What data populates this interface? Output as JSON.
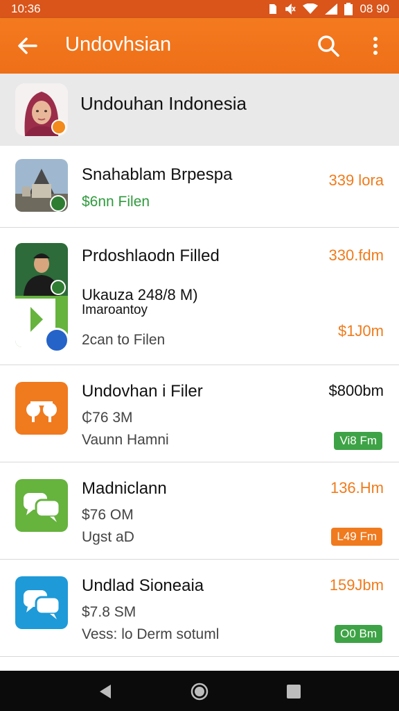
{
  "status_bar": {
    "time": "10:36",
    "clock_right": "08 90"
  },
  "app_bar": {
    "title": "Undovhsian"
  },
  "header": {
    "title": "Undouhan Indonesia"
  },
  "items": [
    {
      "title": "Snahablam Brpespa",
      "sub1": "$6nn Filen",
      "sub2": "",
      "price": "339 lora",
      "price2": "",
      "pill": ""
    },
    {
      "title": "Prdoshlaodn Filled",
      "sub1": "Ukauza 248/8 M)",
      "sub1b": "Imaroantoy",
      "sub2": "2can to Filen",
      "price": "330.fdm",
      "price2": "$1J0m",
      "pill": ""
    },
    {
      "title": "Undovhan i Filer",
      "sub1": "₵76 3M",
      "sub2": "Vaunn Hamni",
      "price": "$800bm",
      "price2": "",
      "pill": "Vi8 Fm"
    },
    {
      "title": "Madniclann",
      "sub1": "$76 OM",
      "sub2": "Ugst aD",
      "price": "136.Hm",
      "price2": "",
      "pill": "L49 Fm"
    },
    {
      "title": "Undlad Sioneaia",
      "sub1": "$7.8 SM",
      "sub2": "Vess: lo Derm sotuml",
      "price": "159Jbm",
      "price2": "",
      "pill": "O0 Bm"
    }
  ],
  "colors": {
    "accent": "#f07a1e",
    "green_pill": "#3ea346",
    "orange_pill": "#f07a1e"
  }
}
